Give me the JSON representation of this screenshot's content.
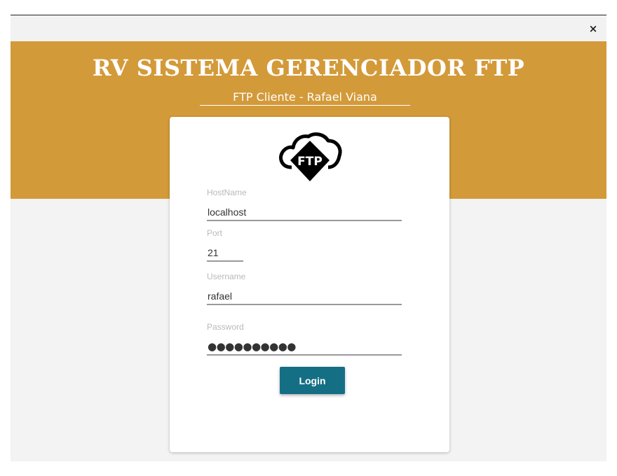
{
  "window": {
    "close_glyph": "×"
  },
  "header": {
    "title": "RV SISTEMA GERENCIADOR FTP",
    "subtitle": "FTP Cliente - Rafael Viana",
    "accent_color": "#d39a39"
  },
  "logo": {
    "icon": "ftp-cloud-icon",
    "text": "FTP"
  },
  "form": {
    "hostname": {
      "label": "HostName",
      "value": "localhost"
    },
    "port": {
      "label": "Port",
      "value": "21"
    },
    "username": {
      "label": "Username",
      "value": "rafael"
    },
    "password": {
      "label": "Password",
      "masked": "●●●●●●●●●●"
    },
    "login_label": "Login",
    "button_color": "#146f85"
  }
}
